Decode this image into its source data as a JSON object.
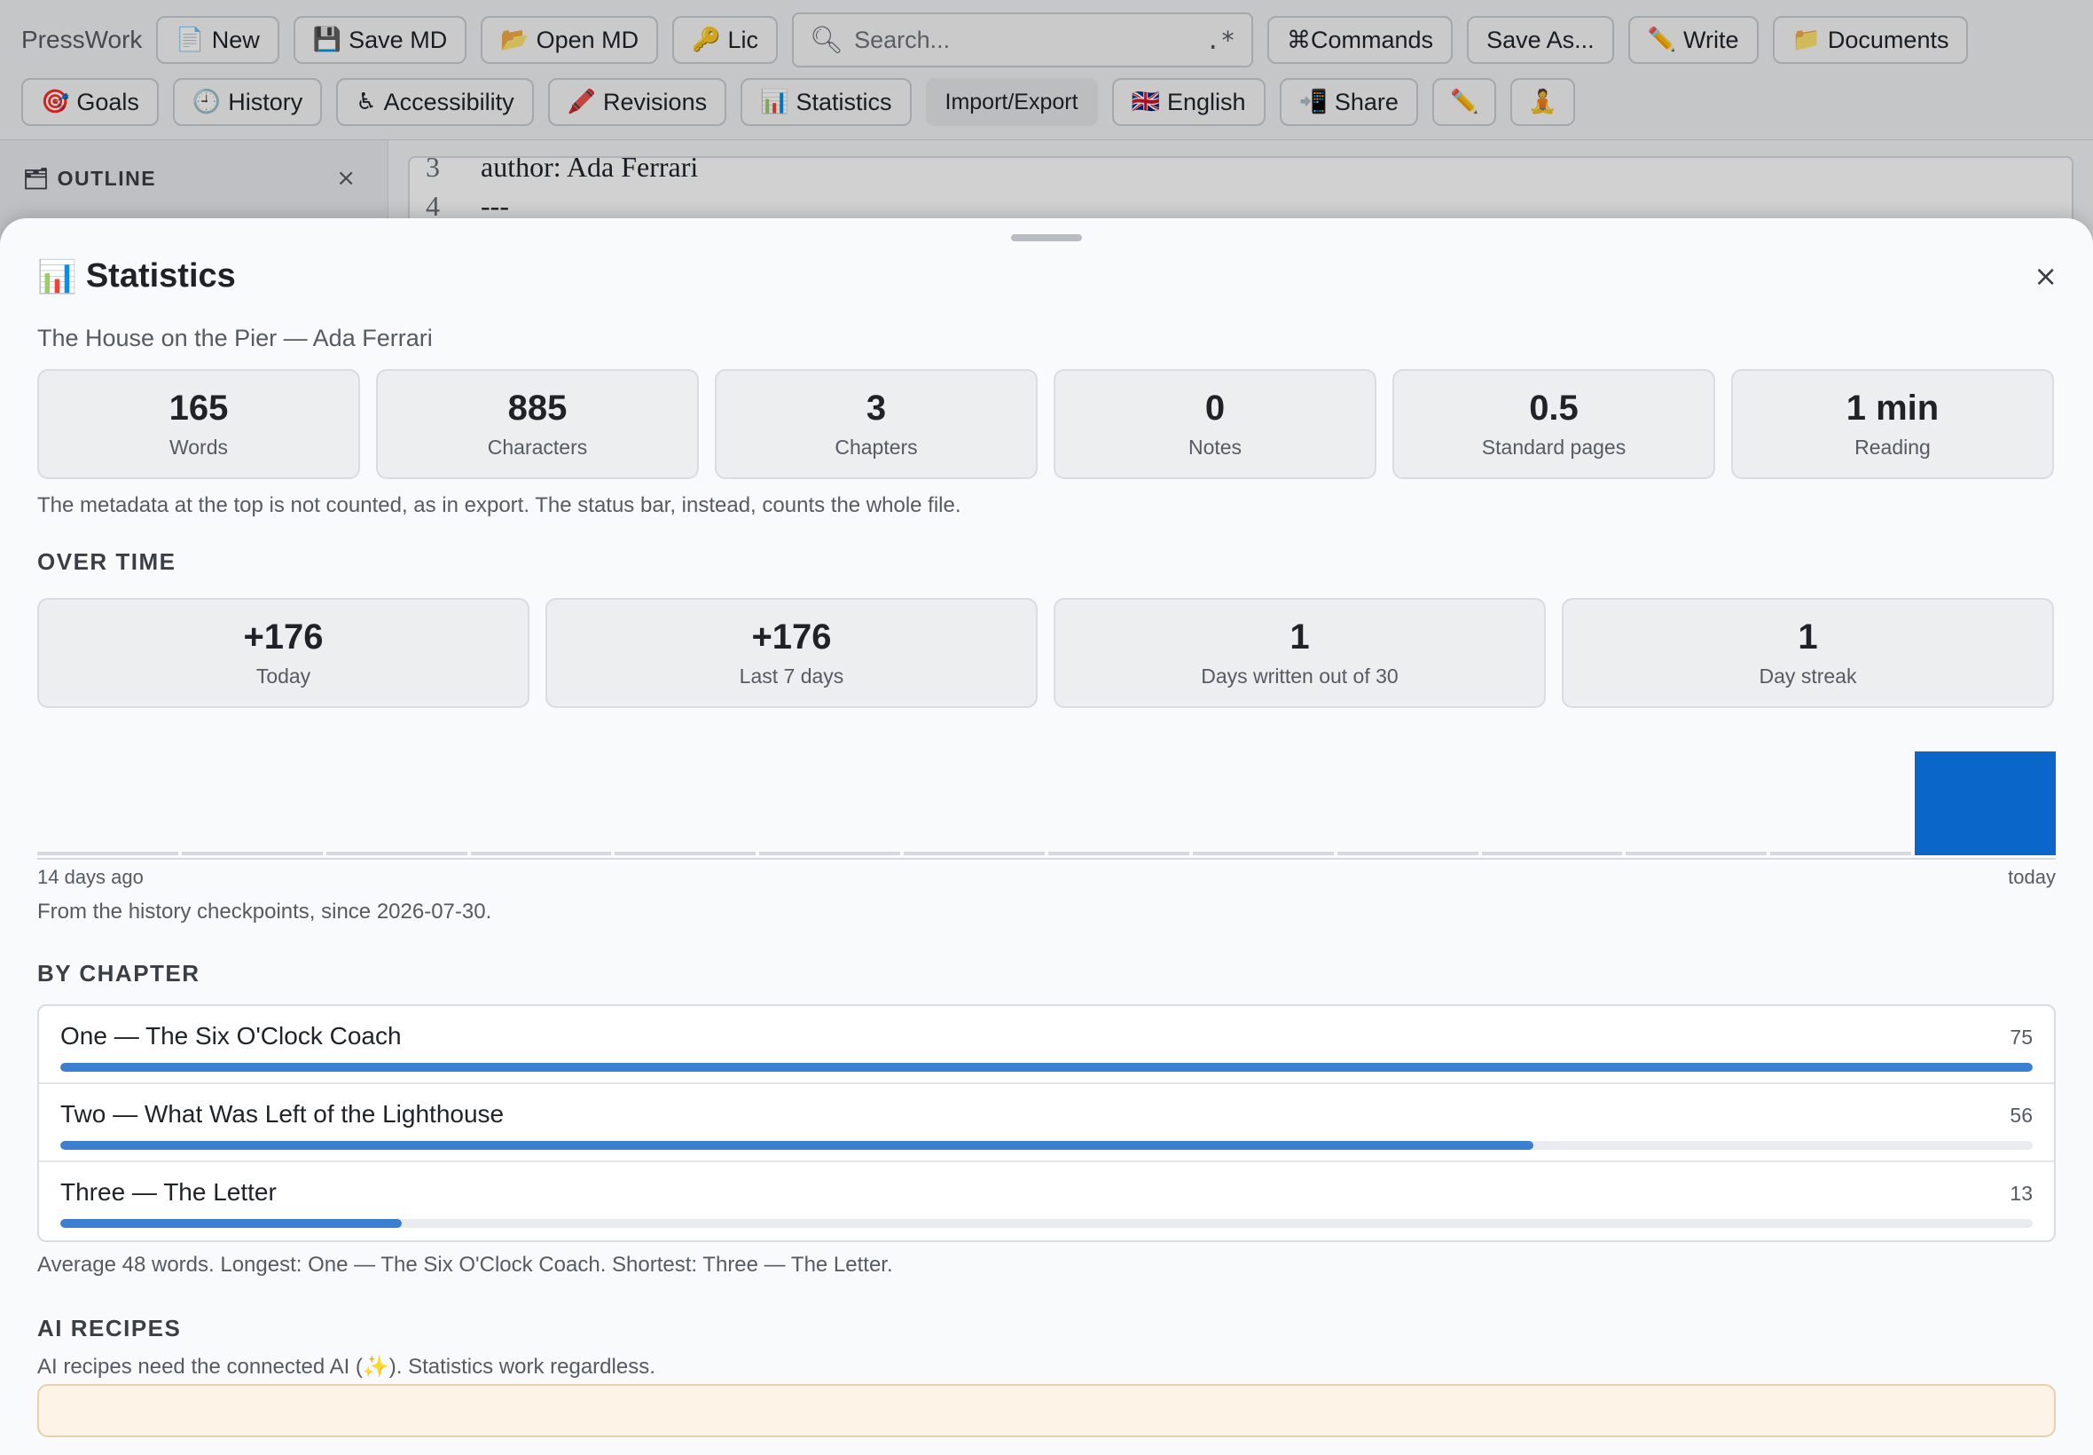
{
  "toolbar": {
    "brand": "PressWork",
    "row1": [
      {
        "name": "new-button",
        "icon": "📄",
        "icon_name": "page-icon",
        "label": "New"
      },
      {
        "name": "save-md-button",
        "icon": "💾",
        "icon_name": "floppy-icon",
        "label": "Save MD"
      },
      {
        "name": "open-md-button",
        "icon": "📂",
        "icon_name": "folder-open-icon",
        "label": "Open MD"
      },
      {
        "name": "license-button",
        "icon": "🔑",
        "icon_name": "key-icon",
        "label": "Lic"
      }
    ],
    "search": {
      "placeholder": "Search...",
      "regex_label": ".*"
    },
    "row1_right": [
      {
        "name": "commands-button",
        "icon": "",
        "label": "⌘Commands"
      },
      {
        "name": "save-as-button",
        "icon": "",
        "label": "Save As..."
      },
      {
        "name": "write-button",
        "icon": "✏️",
        "icon_name": "pencil-icon",
        "label": "Write"
      },
      {
        "name": "documents-button",
        "icon": "📁",
        "icon_name": "folder-icon",
        "label": "Documents"
      }
    ],
    "row2": [
      {
        "name": "goals-button",
        "icon": "🎯",
        "icon_name": "target-icon",
        "label": "Goals"
      },
      {
        "name": "history-button",
        "icon": "🕘",
        "icon_name": "clock-icon",
        "label": "History"
      },
      {
        "name": "accessibility-button",
        "icon": "♿",
        "icon_name": "accessibility-icon",
        "label": "Accessibility"
      },
      {
        "name": "revisions-button",
        "icon": "🖍️",
        "icon_name": "crayon-icon",
        "label": "Revisions"
      },
      {
        "name": "statistics-button",
        "icon": "📊",
        "icon_name": "bar-chart-icon",
        "label": "Statistics"
      }
    ],
    "import_export": "Import/Export",
    "row2_right": [
      {
        "name": "language-button",
        "icon": "🇬🇧",
        "icon_name": "uk-flag-icon",
        "label": "English"
      },
      {
        "name": "share-button",
        "icon": "📲",
        "icon_name": "phone-arrow-icon",
        "label": "Share"
      },
      {
        "name": "edit-icon-button",
        "icon": "✏️",
        "icon_name": "pencil-icon",
        "label": ""
      },
      {
        "name": "focus-mode-button",
        "icon": "🧘",
        "icon_name": "meditation-icon",
        "label": ""
      }
    ]
  },
  "outline": {
    "title": "🗂 OUTLINE",
    "close": "×"
  },
  "editor": {
    "lines": [
      {
        "no": "3",
        "text": "author: Ada Ferrari"
      },
      {
        "no": "4",
        "text": "---"
      }
    ]
  },
  "stats": {
    "icon": "📊",
    "title": "Statistics",
    "close": "×",
    "subtitle": "The House on the Pier — Ada Ferrari",
    "cards": [
      {
        "value": "165",
        "label": "Words"
      },
      {
        "value": "885",
        "label": "Characters"
      },
      {
        "value": "3",
        "label": "Chapters"
      },
      {
        "value": "0",
        "label": "Notes"
      },
      {
        "value": "0.5",
        "label": "Standard pages"
      },
      {
        "value": "1 min",
        "label": "Reading"
      }
    ],
    "metadata_note": "The metadata at the top is not counted, as in export. The status bar, instead, counts the whole file.",
    "over_time": {
      "heading": "OVER TIME",
      "cards": [
        {
          "value": "+176",
          "label": "Today"
        },
        {
          "value": "+176",
          "label": "Last 7 days"
        },
        {
          "value": "1",
          "label": "Days written out of 30"
        },
        {
          "value": "1",
          "label": "Day streak"
        }
      ],
      "axis_start": "14 days ago",
      "axis_end": "today",
      "note": "From the history checkpoints, since 2026-07-30."
    },
    "by_chapter": {
      "heading": "BY CHAPTER",
      "chapters": [
        {
          "name": "One — The Six O'Clock Coach",
          "words": 75
        },
        {
          "name": "Two — What Was Left of the Lighthouse",
          "words": 56
        },
        {
          "name": "Three — The Letter",
          "words": 13
        }
      ],
      "summary": "Average 48 words. Longest: One — The Six O'Clock Coach. Shortest: Three — The Letter."
    },
    "ai_recipes": {
      "heading": "AI RECIPES",
      "note": "AI recipes need the connected AI (✨). Statistics work regardless."
    }
  },
  "chart_data": {
    "type": "bar",
    "x": [
      "14 days ago",
      "",
      "",
      "",
      "",
      "",
      "",
      "",
      "",
      "",
      "",
      "",
      "",
      "today"
    ],
    "values": [
      0,
      0,
      0,
      0,
      0,
      0,
      0,
      0,
      0,
      0,
      0,
      0,
      0,
      176
    ],
    "xlabel": "",
    "ylabel": "",
    "bar_color": "#0a66c8"
  },
  "colors": {
    "accent": "#0a66c8",
    "chapter_bar": "#3a7fd0",
    "recipe_border": "#e8cfae"
  }
}
